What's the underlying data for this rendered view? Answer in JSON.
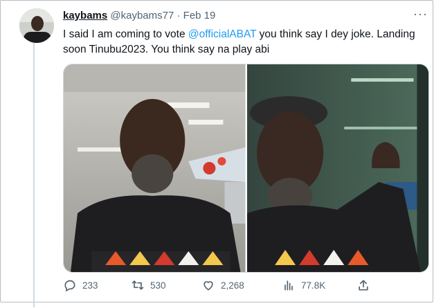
{
  "tweet": {
    "display_name": "kaybams",
    "handle": "@kaybams77",
    "separator": "·",
    "date": "Feb 19",
    "more_label": "···",
    "text_before": "I said I am coming to vote ",
    "mention": "@officialABAT",
    "text_after": " you think say I dey joke. Landing soon Tinubu2023. You think say na play abi"
  },
  "actions": {
    "replies": "233",
    "retweets": "530",
    "likes": "2,268",
    "views": "77.8K"
  },
  "colors": {
    "link": "#1d9bf0",
    "secondary_text": "#536471",
    "border": "#cfd9de"
  },
  "icons": [
    "reply-icon",
    "retweet-icon",
    "like-icon",
    "views-icon",
    "share-icon"
  ]
}
